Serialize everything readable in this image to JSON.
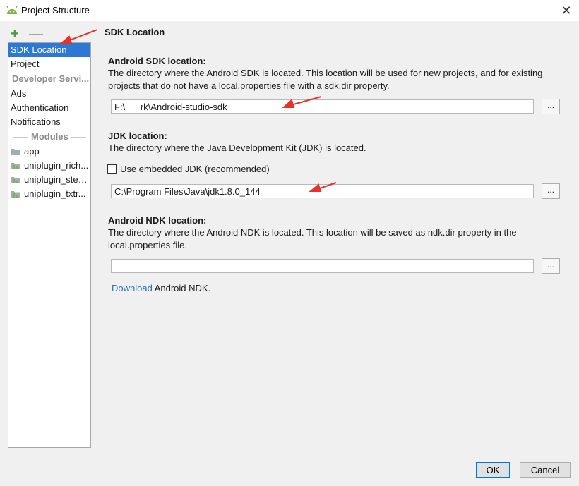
{
  "window": {
    "title": "Project Structure",
    "app_icon": "android-icon",
    "close_glyph": "✕"
  },
  "toolbar": {
    "add_glyph": "+",
    "remove_glyph": "—"
  },
  "sidebar": {
    "items": [
      {
        "label": "SDK Location",
        "active": true
      },
      {
        "label": "Project"
      }
    ],
    "developer_header": "Developer Servi...",
    "developer_items": [
      {
        "label": "Ads"
      },
      {
        "label": "Authentication"
      },
      {
        "label": "Notifications"
      }
    ],
    "modules_label": "Modules",
    "modules": [
      {
        "label": "app",
        "icon": "folder-icon"
      },
      {
        "label": "uniplugin_rich...",
        "icon": "module-icon"
      },
      {
        "label": "uniplugin_step...",
        "icon": "module-icon"
      },
      {
        "label": "uniplugin_txtr...",
        "icon": "module-icon"
      }
    ]
  },
  "main": {
    "panel_title": "SDK Location",
    "sdk": {
      "title": "Android SDK location:",
      "desc": "The directory where the Android SDK is located. This location will be used for new projects, and for existing projects that do not have a local.properties file with a sdk.dir property.",
      "value": "F:\\      rk\\Android-studio-sdk",
      "browse": "..."
    },
    "jdk": {
      "title": "JDK location:",
      "desc": "The directory where the Java Development Kit (JDK) is located.",
      "checkbox_label": "Use embedded JDK (recommended)",
      "checked": false,
      "value": "C:\\Program Files\\Java\\jdk1.8.0_144",
      "browse": "..."
    },
    "ndk": {
      "title": "Android NDK location:",
      "desc": "The directory where the Android NDK is located. This location will be saved as ndk.dir property in the local.properties file.",
      "value": "",
      "browse": "...",
      "download_link": "Download",
      "download_suffix": " Android NDK."
    }
  },
  "buttons": {
    "ok": "OK",
    "cancel": "Cancel"
  },
  "colors": {
    "selection": "#2e78d5",
    "link": "#2470b8",
    "annotation_arrow": "#e8312a"
  }
}
